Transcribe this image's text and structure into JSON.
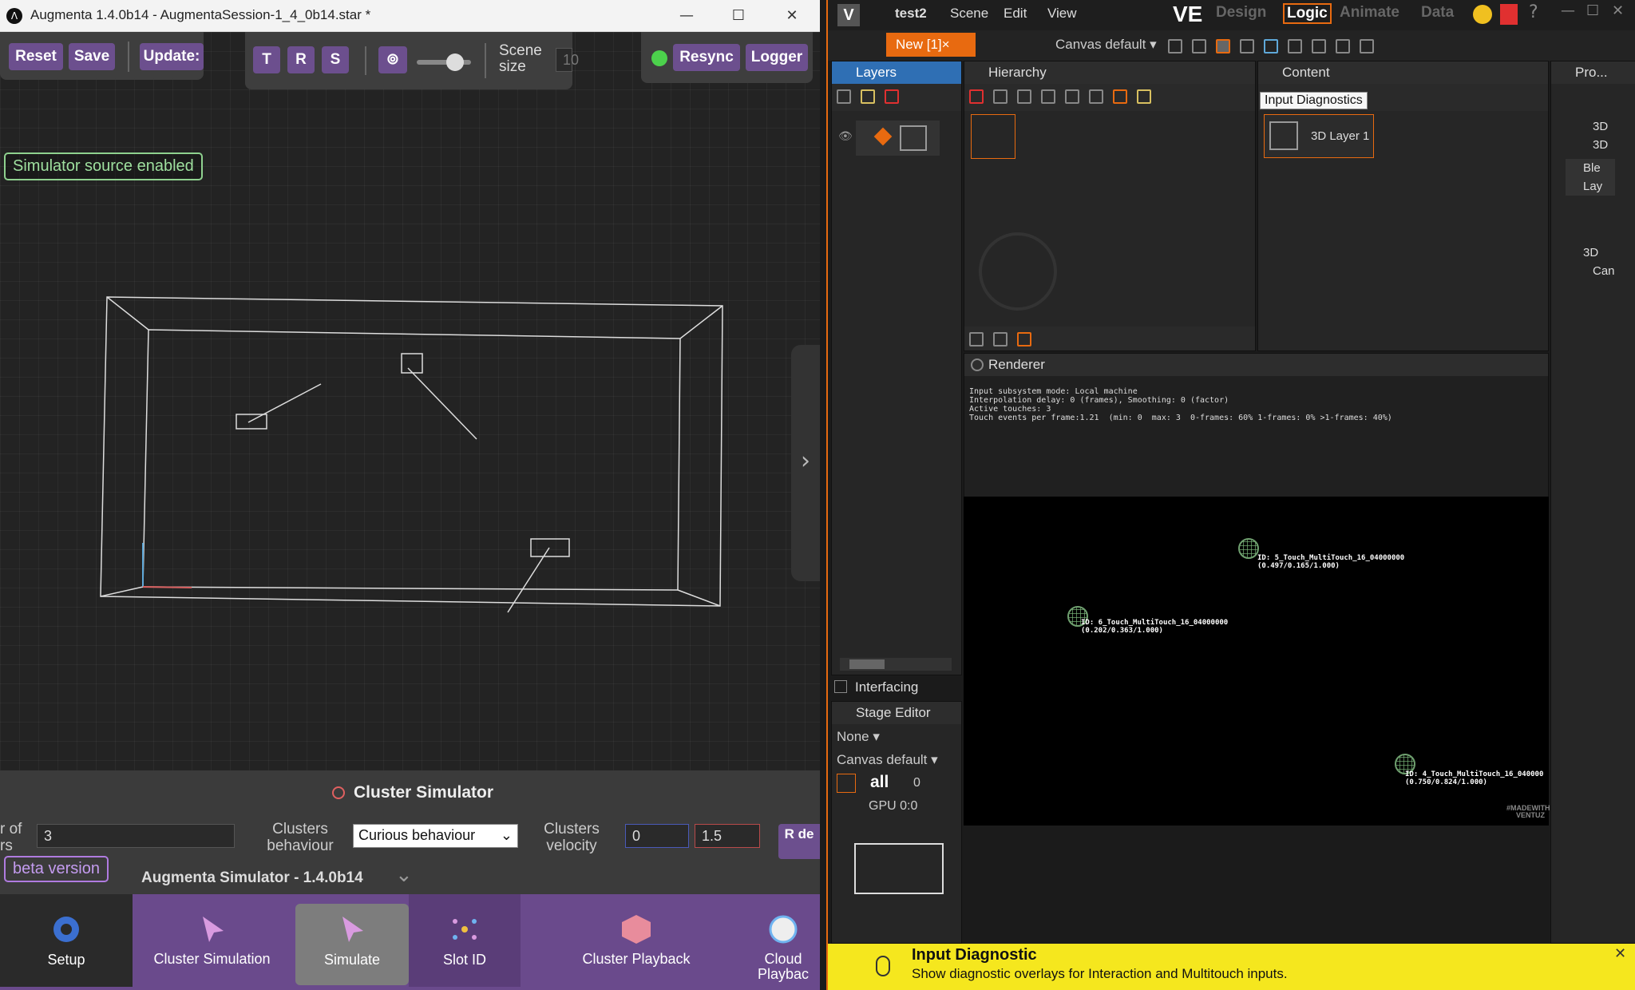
{
  "augmenta": {
    "window_title": "Augmenta 1.4.0b14 - AugmentaSession-1_4_0b14.star *",
    "toolbar": {
      "reset": "Reset",
      "save": "Save",
      "update": "Update:",
      "t": "T",
      "r": "R",
      "s": "S",
      "scene_size_label": "Scene size",
      "scene_size_value": "10",
      "resync": "Resync",
      "logger": "Logger"
    },
    "simulator_badge": "Simulator source enabled",
    "cluster_simulator": {
      "title": "Cluster Simulator",
      "number_label": "r of rs",
      "number_value": "3",
      "behaviour_label": "Clusters behaviour",
      "behaviour_value": "Curious behaviour",
      "velocity_label": "Clusters velocity",
      "velocity_min": "0",
      "velocity_max": "1.5",
      "reset_btn": "R de"
    },
    "beta_badge": "beta version",
    "version_text": "Augmenta Simulator - 1.4.0b14",
    "bottom_nav": [
      "Setup",
      "Cluster Simulation",
      "Simulate",
      "Slot ID",
      "Cluster Playback",
      "Cloud Playbac"
    ]
  },
  "ventuz": {
    "project": "test2",
    "menu": [
      "Scene",
      "Edit",
      "View"
    ],
    "logo_text": "VE",
    "modes": [
      "Design",
      "Logic",
      "Animate",
      "Data"
    ],
    "active_mode": "Logic",
    "new_tab": "New [1]×",
    "canvas_dropdown": "Canvas default",
    "tooltip": "Input Diagnostics",
    "panels": {
      "layers": "Layers",
      "hierarchy": "Hierarchy",
      "content": "Content",
      "properties": "Pro...",
      "renderer": "Renderer",
      "stage_editor": "Stage Editor"
    },
    "content_item": "3D Layer 1",
    "interfacing": "Interfacing",
    "stage": {
      "none": "None",
      "canvas": "Canvas default",
      "all": "all",
      "all_count": "0",
      "gpu": "GPU 0:0"
    },
    "properties_items": [
      "3D",
      "3D",
      "Ble",
      "Lay",
      "3D",
      "Can"
    ],
    "renderer_info": [
      "Input subsystem mode: Local machine",
      "Interpolation delay: 0 (frames), Smoothing: 0 (factor)",
      "Active touches: 3",
      "Touch events per frame:1.21  (min: 0  max: 3  0-frames: 60% 1-frames: 0% >1-frames: 40%)"
    ],
    "touches": [
      {
        "id": "ID: 5_Touch_MultiTouch_16_04000000",
        "coords": "(0.497/0.165/1.000)"
      },
      {
        "id": "ID: 6_Touch_MultiTouch_16_04000000",
        "coords": "(0.202/0.363/1.000)"
      },
      {
        "id": "ID: 4_Touch_MultiTouch_16_040000",
        "coords": "(0.750/0.824/1.000)"
      }
    ],
    "watermark": "#MADEWITH VENTUZ",
    "notification": {
      "title": "Input Diagnostic",
      "body": "Show diagnostic overlays for Interaction and Multitouch inputs."
    }
  }
}
